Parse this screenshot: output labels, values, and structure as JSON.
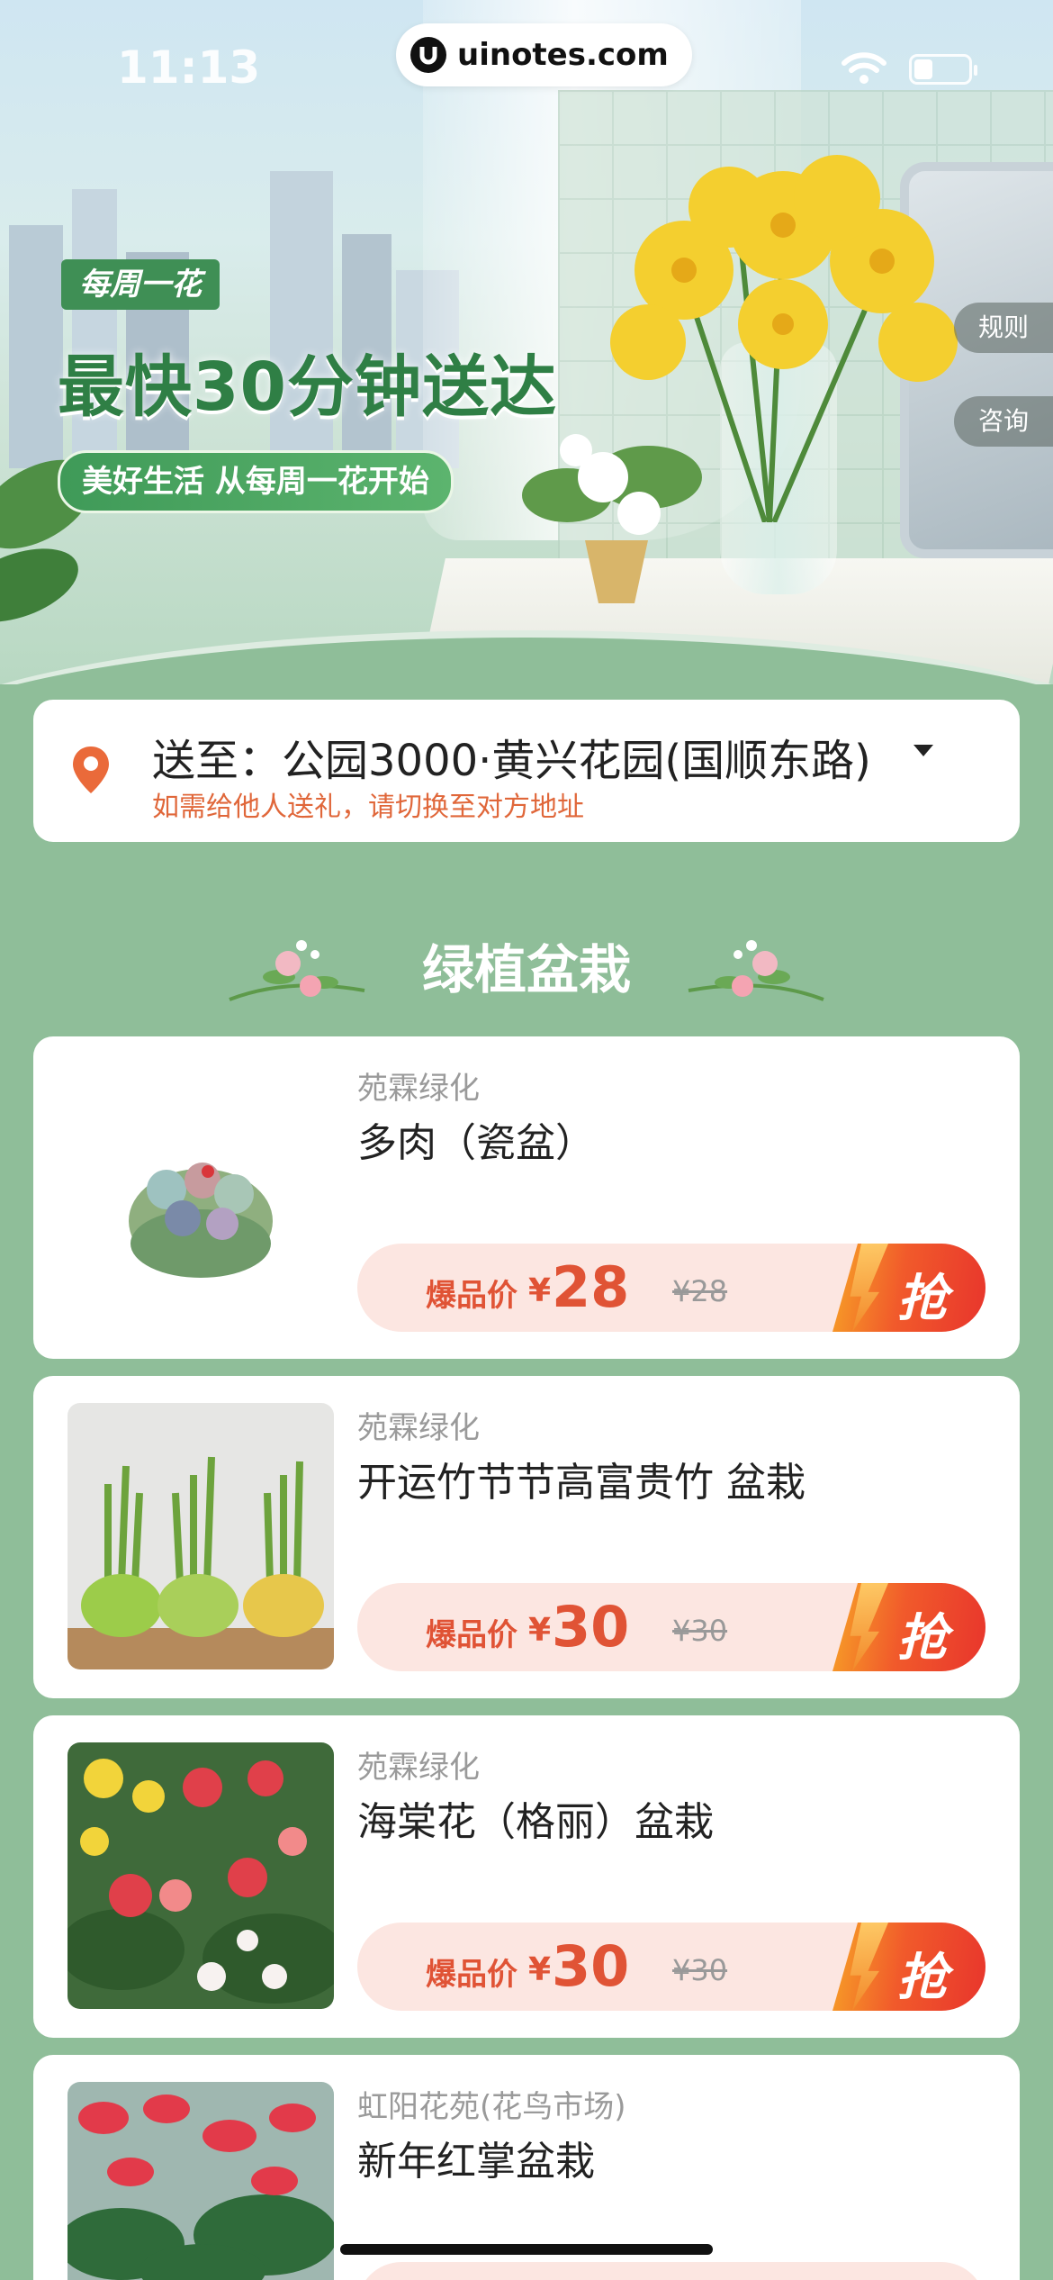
{
  "status_bar": {
    "time": "11:13",
    "url": "uinotes.com"
  },
  "banner": {
    "tag": "每周一花",
    "headline": "最快30分钟送达",
    "slogan": "美好生活 从每周一花开始",
    "rules_label": "规则",
    "consult_label": "咨询"
  },
  "address": {
    "main": "送至：公园3000·黄兴花园(国顺东路)",
    "hint": "如需给他人送礼，请切换至对方地址"
  },
  "section": {
    "title": "绿植盆栽"
  },
  "products": [
    {
      "shop": "苑霖绿化",
      "name": "多肉（瓷盆）",
      "price_label": "爆品价",
      "currency": "¥",
      "price": "28",
      "old_price": "¥28",
      "action": "抢"
    },
    {
      "shop": "苑霖绿化",
      "name": "开运竹节节高富贵竹 盆栽",
      "price_label": "爆品价",
      "currency": "¥",
      "price": "30",
      "old_price": "¥30",
      "action": "抢"
    },
    {
      "shop": "苑霖绿化",
      "name": "海棠花（格丽）盆栽",
      "price_label": "爆品价",
      "currency": "¥",
      "price": "30",
      "old_price": "¥30",
      "action": "抢"
    },
    {
      "shop": "虹阳花苑(花鸟市场)",
      "name": "新年红掌盆栽"
    }
  ],
  "colors": {
    "page_bg": "#8fbe99",
    "accent_green": "#2f7f45",
    "price_red": "#e05335",
    "hint_orange": "#e0673a"
  },
  "icons": [
    "location-pin-icon",
    "dropdown-caret-icon",
    "wifi-icon",
    "battery-icon",
    "uinotes-logo-icon"
  ]
}
